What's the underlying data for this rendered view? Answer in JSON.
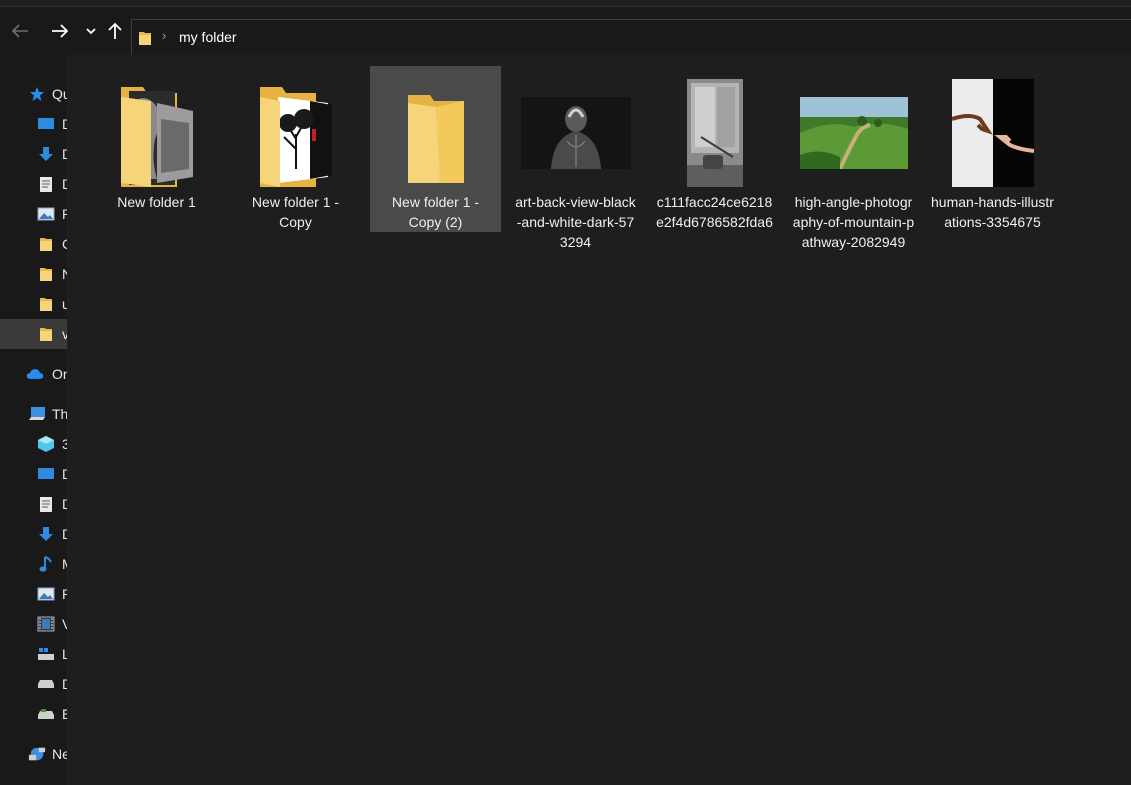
{
  "window": {
    "accent": "#0078d7",
    "background": "#1c1c1c"
  },
  "nav": {
    "back_icon": "back-arrow-icon",
    "forward_icon": "forward-arrow-icon",
    "recent_icon": "chevron-down-icon",
    "up_icon": "up-arrow-icon"
  },
  "address": {
    "separator": "›",
    "crumb": "my folder"
  },
  "sidebar": {
    "items": [
      {
        "label": "Qu",
        "icon": "star-icon"
      },
      {
        "label": "D",
        "icon": "desktop-icon"
      },
      {
        "label": "D",
        "icon": "downloads-icon"
      },
      {
        "label": "D",
        "icon": "documents-icon"
      },
      {
        "label": "P",
        "icon": "pictures-icon"
      },
      {
        "label": "C",
        "icon": "folder-icon"
      },
      {
        "label": "N",
        "icon": "folder-icon"
      },
      {
        "label": "u",
        "icon": "folder-icon"
      },
      {
        "label": "v",
        "icon": "folder-icon"
      },
      {
        "label": "On",
        "icon": "cloud-icon"
      },
      {
        "label": "Th",
        "icon": "pc-icon"
      },
      {
        "label": "3",
        "icon": "3d-objects-icon"
      },
      {
        "label": "D",
        "icon": "desktop-icon"
      },
      {
        "label": "D",
        "icon": "documents-icon"
      },
      {
        "label": "D",
        "icon": "downloads-icon"
      },
      {
        "label": "M",
        "icon": "music-icon"
      },
      {
        "label": "P",
        "icon": "pictures-icon"
      },
      {
        "label": "V",
        "icon": "videos-icon"
      },
      {
        "label": "L",
        "icon": "local-disk-icon"
      },
      {
        "label": "D",
        "icon": "drive-icon"
      },
      {
        "label": "E",
        "icon": "drive-icon"
      },
      {
        "label": "Ne",
        "icon": "network-icon"
      }
    ]
  },
  "files": [
    {
      "name": "New folder 1",
      "type": "folder"
    },
    {
      "name": "New folder 1 - Copy",
      "type": "folder"
    },
    {
      "name": "New folder 1 - Copy (2)",
      "type": "folder",
      "selected": true
    },
    {
      "name": "art-back-view-black-and-white-dark-573294",
      "type": "image"
    },
    {
      "name": "c111facc24ce6218e2f4d6786582fda6",
      "type": "image"
    },
    {
      "name": "high-angle-photography-of-mountain-pathway-2082949",
      "type": "image"
    },
    {
      "name": "human-hands-illustrations-3354675",
      "type": "image"
    }
  ]
}
